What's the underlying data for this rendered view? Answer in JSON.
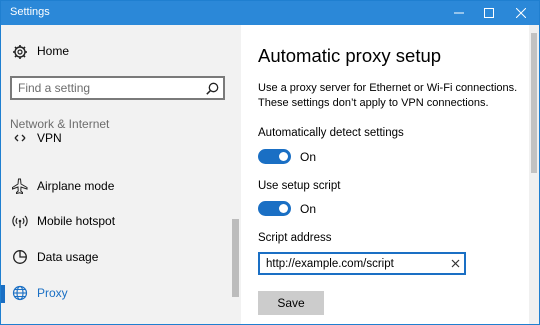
{
  "window": {
    "title": "Settings",
    "accent": "#2b88d8",
    "controls": [
      "minimize-icon",
      "maximize-icon",
      "close-icon"
    ]
  },
  "sidebar": {
    "home_label": "Home",
    "search_placeholder": "Find a setting",
    "section_title": "Network & Internet",
    "items": [
      {
        "label": "VPN",
        "icon": "vpn-icon"
      },
      {
        "label": "Airplane mode",
        "icon": "airplane-icon"
      },
      {
        "label": "Mobile hotspot",
        "icon": "hotspot-icon"
      },
      {
        "label": "Data usage",
        "icon": "data-usage-icon"
      },
      {
        "label": "Proxy",
        "icon": "globe-icon",
        "selected": true
      }
    ]
  },
  "content": {
    "title": "Automatic proxy setup",
    "description": "Use a proxy server for Ethernet or Wi-Fi connections. These settings don’t apply to VPN connections.",
    "auto_detect": {
      "label": "Automatically detect settings",
      "state": "On"
    },
    "setup_script": {
      "label": "Use setup script",
      "state": "On"
    },
    "script_address": {
      "label": "Script address",
      "value": "http://example.com/script"
    },
    "save_label": "Save"
  },
  "colors": {
    "selected_text": "#1a6fc4",
    "toggle_on": "#1a6fc4",
    "sidebar_bg": "#f2f2f2"
  }
}
